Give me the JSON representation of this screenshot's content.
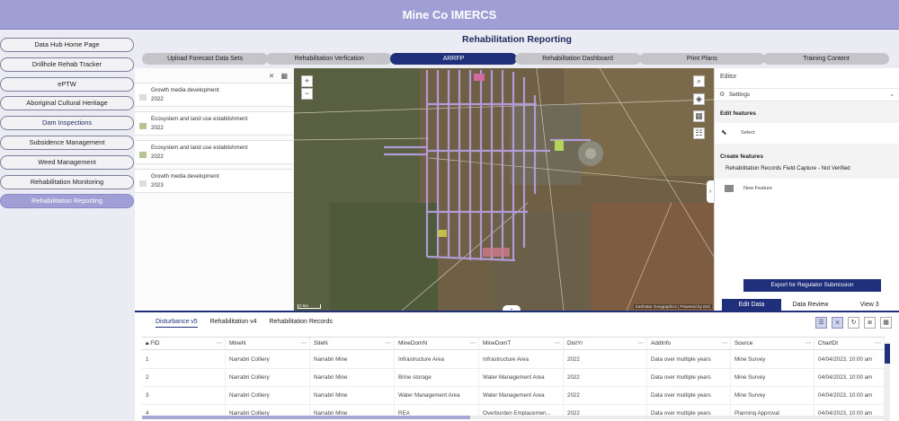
{
  "header": {
    "title": "Mine Co IMERCS"
  },
  "nav": {
    "items": [
      {
        "label": "Data Hub Home Page"
      },
      {
        "label": "Drillhole Rehab Tracker"
      },
      {
        "label": "ePTW"
      },
      {
        "label": "Aboriginal Cultural Heritage"
      },
      {
        "label": "Dam Inspections"
      },
      {
        "label": "Subsidence Management"
      },
      {
        "label": "Weed Management"
      },
      {
        "label": "Rehabilitation Monitoring"
      },
      {
        "label": "Rehabilitation Reporting"
      }
    ]
  },
  "page": {
    "title": "Rehabilitation Reporting"
  },
  "tabs": [
    {
      "label": "Upload Forecast Data Sets"
    },
    {
      "label": "Rehabilitation Verfication"
    },
    {
      "label": "ARRFP"
    },
    {
      "label": "Rehabilitation Dashboard"
    },
    {
      "label": "Print Plans"
    },
    {
      "label": "Training Content"
    }
  ],
  "features": [
    {
      "title": "Growth media development",
      "year": "2022"
    },
    {
      "title": "Ecosystem and land use establishment",
      "year": "2022"
    },
    {
      "title": "Ecosystem and land use establishment",
      "year": "2022"
    },
    {
      "title": "Growth media development",
      "year": "2023"
    }
  ],
  "map": {
    "attribution": "Earthstar Geographics | Powered by Esri",
    "scale": "2 km"
  },
  "editor": {
    "title": "Editor",
    "settings": "Settings",
    "edit_features": "Edit features",
    "select": "Select",
    "create_features": "Create features",
    "layer": "Rehabilitation Records Field Capture - Not Verified",
    "new_feature": "New Feature",
    "export": "Export for Regulator Submission"
  },
  "bottom_tabs": [
    {
      "label": "Edit Data"
    },
    {
      "label": "Data Review"
    },
    {
      "label": "View 3"
    }
  ],
  "table": {
    "tabs": [
      "Disturbance v5",
      "Rehabilitation v4",
      "Rehabilitation Records"
    ],
    "columns": [
      "FID",
      "MineN",
      "SiteN",
      "MineDomN",
      "MineDomT",
      "DistYr",
      "AddInfo",
      "Source",
      "ChartDt"
    ],
    "rows": [
      [
        "1",
        "Narrabri Colliery",
        "Narrabri Mine",
        "Infrastructure Area",
        "Infrastructure Area",
        "2022",
        "Data over multiple years",
        "Mine Survey",
        "04/04/2023, 10:00 am"
      ],
      [
        "2",
        "Narrabri Colliery",
        "Narrabri Mine",
        "Brine storage",
        "Water Management Area",
        "2022",
        "Data over multiple years",
        "Mine Survey",
        "04/04/2023, 10:00 am"
      ],
      [
        "3",
        "Narrabri Colliery",
        "Narrabri Mine",
        "Water Management Area",
        "Water Management Area",
        "2022",
        "Data over multiple years",
        "Mine Survey",
        "04/04/2023, 10:00 am"
      ],
      [
        "4",
        "Narrabri Colliery",
        "Narrabri Mine",
        "REA",
        "Overburden Emplacemen...",
        "2022",
        "Data over multiple years",
        "Planning Approval",
        "04/04/2023, 10:00 am"
      ]
    ]
  },
  "colors": {
    "accent": "#1f2f7a",
    "header": "#9f9fd6"
  }
}
